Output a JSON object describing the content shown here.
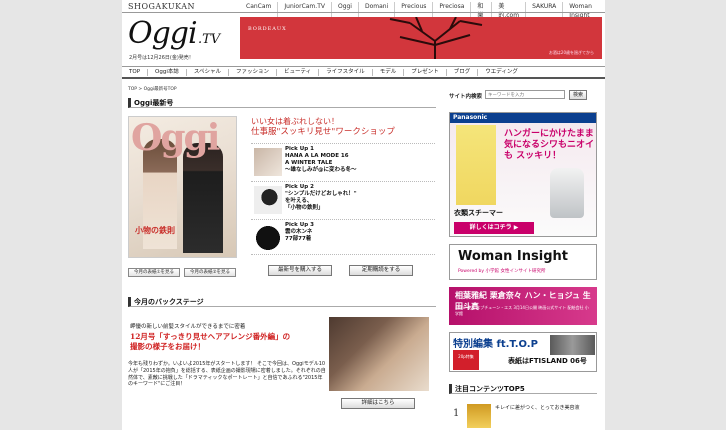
{
  "header": {
    "brand": "SHOGAKUKAN",
    "sites": [
      "CanCam",
      "JuniorCam.TV",
      "Oggi",
      "Domani",
      "Precious",
      "Preciosa",
      "和樂",
      "美的.com",
      "SAKURA",
      "Woman Insight"
    ],
    "logo": "Oggi",
    "logo_suffix": ".TV",
    "issue_note": "2月号は12月26日(金)発売！",
    "banner_text": "BORDEAUX",
    "banner_sub": "お酒は20歳を過ぎてから"
  },
  "nav": [
    "TOP",
    "Oggi本誌",
    "スペシャル",
    "ファッション",
    "ビューティ",
    "ライフスタイル",
    "モデル",
    "プレゼント",
    "ブログ",
    "ウエディング"
  ],
  "breadcrumb": "TOP > Oggi最新号TOP",
  "latest": {
    "section_title": "Oggi最新号",
    "cover_title": "Oggi",
    "cover_copy": "小物の鉄則",
    "btn_prev": "今月の表紙①を見る",
    "btn_next": "今月の表紙②を見る",
    "catch1": "いい女は着ぶれしない！",
    "catch2": "仕事服\"スッキリ見せ\"ワークショップ",
    "picks": [
      {
        "label": "Pick Up 1",
        "line1": "HANA A LA MODE 16",
        "line2": "A WINTER TALE",
        "line3": "〜雄なしみが@に変わる冬〜"
      },
      {
        "label": "Pick Up 2",
        "line1": "\"シンプルだけどおしゃれ！\"",
        "line2": "を叶える、",
        "line3": "「小物の鉄則」"
      },
      {
        "label": "Pick Up 3",
        "line1": "雲の木ンネ",
        "line2": "77部77着",
        "line3": ""
      }
    ],
    "buy_btn": "最新号を購入する",
    "subscribe_btn": "定期購読をする"
  },
  "backstage": {
    "section_title": "今月のバックステージ",
    "lead": "岬優の新しい前髪スタイルができるまでに密着",
    "head1": "12月号「すっきり見せヘアアレンジ番外編」の",
    "head2": "撮影の様子をお届け！",
    "body": "今年も残りわずか。いよいよ2015年がスタートします！ そこで今回は、Oggiモデル10人が「2015年の抱負」を総括する、表紙企画の撮影現場に密着しました。それぞれの自然体で、素敵に挑戦した「ドラマティックなポートレート」と自信であふれる\"2015年のキーワード\"にご注目！",
    "detail_btn": "詳細はこちら"
  },
  "sidebar": {
    "search_label": "サイト内検索",
    "search_placeholder": "キーワードを入力",
    "search_btn": "検索",
    "panasonic": {
      "logo": "Panasonic",
      "head": "ハンガーにかけたまま 気になるシワもニオイも スッキリ！",
      "product": "衣類スチーマー",
      "cta": "詳しくはコチラ ▶"
    },
    "woman_insight": {
      "title": "Woman Insight",
      "sub": "Powered by 小学館 女性インサイト研究所"
    },
    "drama": {
      "head": "相葉雅紀 栗倉奈々 ハン・ヒョジュ 生田斗真",
      "sub": "出演：波乱 ネプチューン・エス 3月14日公開 映画公式サイト 配給会社 小学館"
    },
    "special": {
      "head": "特別編集 ft.T.O.P",
      "tag": "20p特集",
      "tail": "表紙はFTISLAND 06号"
    },
    "top5_title": "注目コンテンツTOP5",
    "rank1": {
      "num": "1",
      "text": "キレイに差がつく、とっておき美容液"
    }
  }
}
